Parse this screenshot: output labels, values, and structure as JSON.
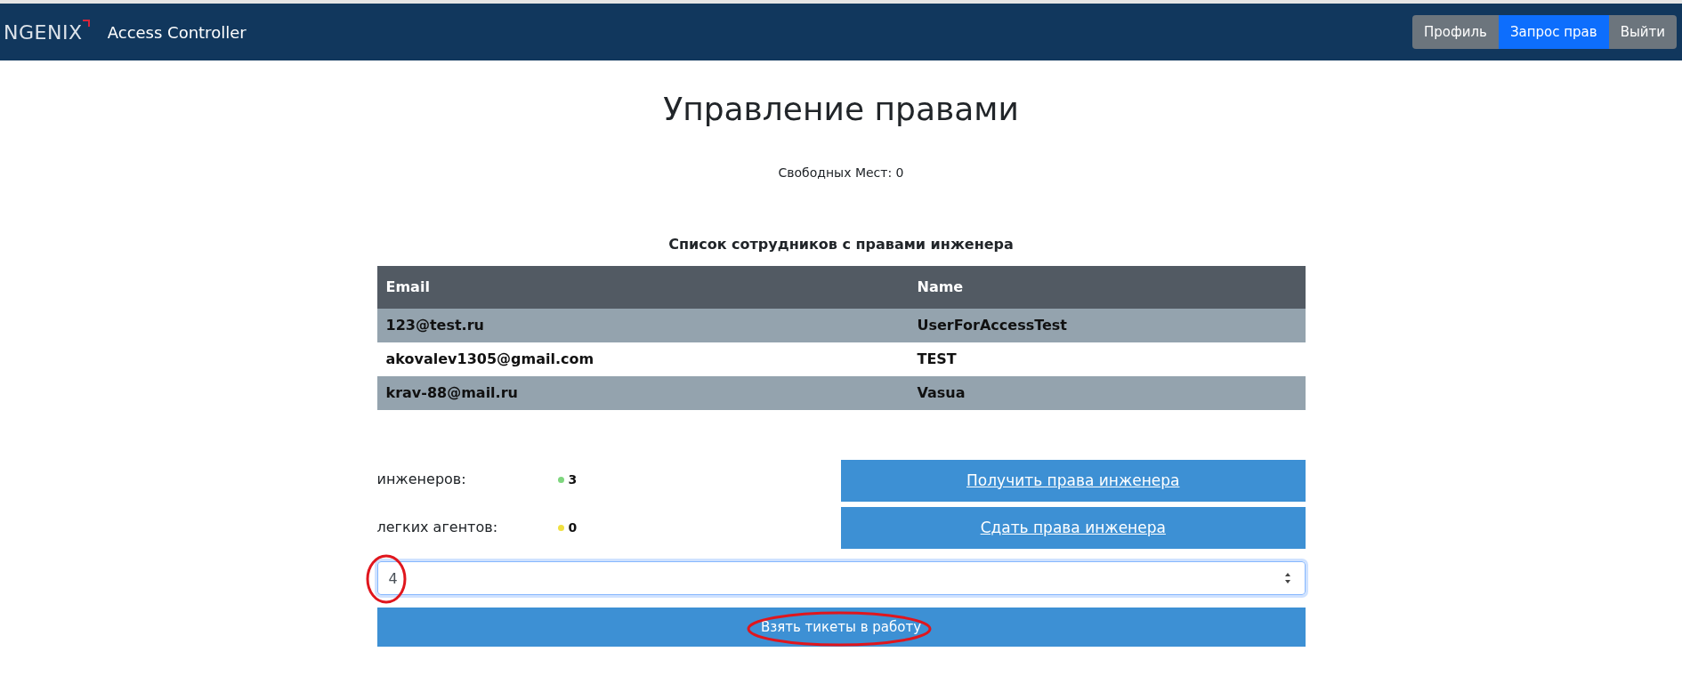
{
  "navbar": {
    "logo": "NGENIX",
    "title": "Access Controller",
    "buttons": [
      {
        "label": "Профиль",
        "selected": false
      },
      {
        "label": "Запрос прав",
        "selected": true
      },
      {
        "label": "Выйти",
        "selected": false
      }
    ]
  },
  "heading": "Управление правами",
  "free_seats": "Свободных Мест: 0",
  "table": {
    "caption": "Список сотрудников с правами инженера",
    "columns": [
      "Email",
      "Name"
    ],
    "rows": [
      [
        "123@test.ru",
        "UserForAccessTest"
      ],
      [
        "akovalev1305@gmail.com",
        "TEST"
      ],
      [
        "krav-88@mail.ru",
        "Vasua"
      ]
    ]
  },
  "counters": [
    {
      "label": "инженеров:",
      "value": "3",
      "color": "#7ed67e"
    },
    {
      "label": "легких агентов:",
      "value": "0",
      "color": "#f0e040"
    }
  ],
  "rights_buttons": [
    "Получить права инженера",
    "Сдать права инженера"
  ],
  "ticket_count": {
    "value": "4"
  },
  "take_button": "Взять тикеты в работу"
}
